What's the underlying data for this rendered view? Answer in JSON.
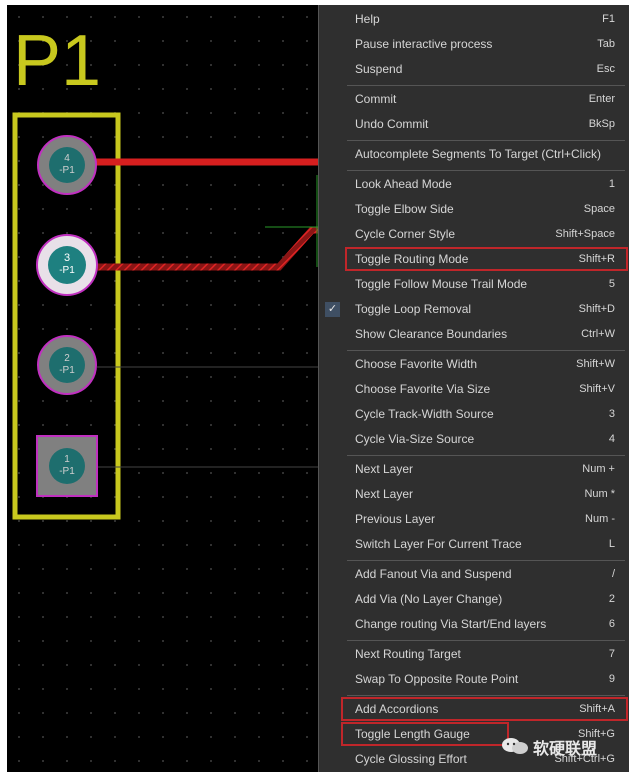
{
  "board": {
    "component_label": "P1",
    "pads": [
      {
        "number": "4",
        "net": "-P1"
      },
      {
        "number": "3",
        "net": "-P1"
      },
      {
        "number": "2",
        "net": "-P1"
      },
      {
        "number": "1",
        "net": "-P1"
      }
    ],
    "colors": {
      "background": "#000000",
      "silkscreen": "#c8c81e",
      "trace": "#d61f1f",
      "pad_fill": "#808080",
      "pad_center": "#1e6e6e",
      "pad_outline": "#c030c0",
      "highlight_pad": "#e8e0e8"
    }
  },
  "menu": {
    "items": [
      {
        "label": "Help",
        "shortcut": "F1"
      },
      {
        "label": "Pause interactive process",
        "shortcut": "Tab"
      },
      {
        "label": "Suspend",
        "shortcut": "Esc"
      },
      {
        "label": "Commit",
        "shortcut": "Enter"
      },
      {
        "label": "Undo Commit",
        "shortcut": "BkSp"
      },
      {
        "label": "Autocomplete Segments To Target (Ctrl+Click)",
        "shortcut": ""
      },
      {
        "label": "Look Ahead Mode",
        "shortcut": "1"
      },
      {
        "label": "Toggle Elbow Side",
        "shortcut": "Space"
      },
      {
        "label": "Cycle Corner Style",
        "shortcut": "Shift+Space"
      },
      {
        "label": "Toggle Routing Mode",
        "shortcut": "Shift+R"
      },
      {
        "label": "Toggle Follow Mouse Trail Mode",
        "shortcut": "5"
      },
      {
        "label": "Toggle Loop Removal",
        "shortcut": "Shift+D",
        "checked": true
      },
      {
        "label": "Show Clearance Boundaries",
        "shortcut": "Ctrl+W"
      },
      {
        "label": "Choose Favorite Width",
        "shortcut": "Shift+W"
      },
      {
        "label": "Choose Favorite Via Size",
        "shortcut": "Shift+V"
      },
      {
        "label": "Cycle Track-Width Source",
        "shortcut": "3"
      },
      {
        "label": "Cycle Via-Size Source",
        "shortcut": "4"
      },
      {
        "label": "Next Layer",
        "shortcut": "Num +"
      },
      {
        "label": "Next Layer",
        "shortcut": "Num *"
      },
      {
        "label": "Previous Layer",
        "shortcut": "Num -"
      },
      {
        "label": "Switch Layer For Current Trace",
        "shortcut": "L"
      },
      {
        "label": "Add Fanout Via and Suspend",
        "shortcut": "/"
      },
      {
        "label": "Add Via (No Layer Change)",
        "shortcut": "2"
      },
      {
        "label": "Change routing Via Start/End layers",
        "shortcut": "6"
      },
      {
        "label": "Next Routing Target",
        "shortcut": "7"
      },
      {
        "label": "Swap To Opposite Route Point",
        "shortcut": "9"
      },
      {
        "label": "Add Accordions",
        "shortcut": "Shift+A"
      },
      {
        "label": "Toggle Length Gauge",
        "shortcut": "Shift+G"
      },
      {
        "label": "Cycle Glossing Effort",
        "shortcut": "Shift+Ctrl+G"
      }
    ],
    "check_glyph": "✓",
    "colors": {
      "background": "#2f2f2f",
      "text": "#d6d6d6",
      "separator": "#555555",
      "annotation": "#c0262a"
    }
  },
  "watermark": {
    "text": "软硬联盟",
    "icon": "wechat-icon"
  }
}
